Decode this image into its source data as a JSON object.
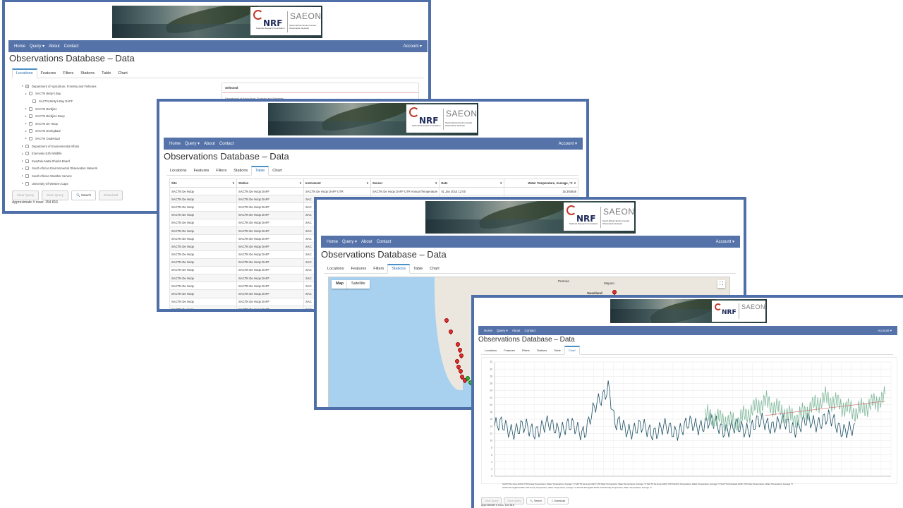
{
  "common": {
    "title": "Observations Database – Data",
    "nav": {
      "home": "Home",
      "query": "Query ▾",
      "about": "About",
      "contact": "Contact",
      "account": "Account ▾"
    },
    "logo": {
      "nrf": "NRF",
      "nrf_sub": "National Research Foundation",
      "saeon": "SAEON",
      "saeon_sub": "South African Environmental Observation Network"
    }
  },
  "w1": {
    "tabs": [
      "Locations",
      "Features",
      "Filters",
      "Stations",
      "Table",
      "Chart"
    ],
    "tree": [
      {
        "label": "Department of Agriculture, Forestry and Fisheries",
        "toggle": "▾",
        "indent": 0
      },
      {
        "label": "SACTN Betty's Bay",
        "toggle": "▸",
        "indent": 1
      },
      {
        "label": "SACTN Betty's Bay DAFF",
        "toggle": "",
        "indent": 2
      },
      {
        "label": "SACTN Bordjies",
        "toggle": "▸",
        "indent": 1
      },
      {
        "label": "SACTN Bordjies Deep",
        "toggle": "▸",
        "indent": 1
      },
      {
        "label": "SACTN De Hoop",
        "toggle": "▸",
        "indent": 1
      },
      {
        "label": "SACTN Doringbaai",
        "toggle": "▸",
        "indent": 1
      },
      {
        "label": "SACTN Oudekraal",
        "toggle": "▸",
        "indent": 1
      },
      {
        "label": "Department of Environmental Affairs",
        "toggle": "▸",
        "indent": 0
      },
      {
        "label": "Ezemvelo KZN Wildlife",
        "toggle": "▸",
        "indent": 0
      },
      {
        "label": "KwaZulu-Natal Sharks Board",
        "toggle": "▸",
        "indent": 0
      },
      {
        "label": "South African Environmental Observation Network",
        "toggle": "▸",
        "indent": 0
      },
      {
        "label": "South African Weather Service",
        "toggle": "▸",
        "indent": 0
      },
      {
        "label": "University Of Western Cape",
        "toggle": "▸",
        "indent": 0
      }
    ],
    "selected_header": "Selected",
    "selected_item": "Department of Agriculture, Forestry and Fisheries",
    "buttons": [
      "Clear Query",
      "Save Query",
      "🔍 Search",
      "Download"
    ],
    "rows_text": "Approximate # rows: 154 816"
  },
  "w2": {
    "tabs": [
      "Locations",
      "Features",
      "Filters",
      "Stations",
      "Table",
      "Chart"
    ],
    "columns": [
      "Site",
      "Station",
      "Instrument",
      "Sensor",
      "Date",
      "Water Temperature, Average, °C"
    ],
    "first_row": [
      "SACTN De Hoop",
      "SACTN De Hoop DAFF",
      "SACTN De Hoop DAFF UTR",
      "SACTN De Hoop DAFF UTR Annual Temperature",
      "01 Jan 2014 12:00",
      "16.393648"
    ],
    "site": "SACTN De Hoop",
    "station": "SACTN De Hoop DAFF",
    "instrument_prefix": "SAC"
  },
  "w3": {
    "tabs": [
      "Locations",
      "Features",
      "Filters",
      "Stations",
      "Table",
      "Chart"
    ],
    "map_btn": "Map",
    "sat_btn": "Satellite",
    "places": {
      "pretoria": "Pretoria",
      "swaziland": "Swaziland",
      "maputo": "Maputo"
    }
  },
  "w4": {
    "tabs": [
      "Locations",
      "Features",
      "Filters",
      "Stations",
      "Table",
      "Chart"
    ],
    "buttons": [
      "Clear Query",
      "Save Query",
      "🔍 Search",
      "⇩ Download"
    ],
    "rows_text": "Approximate # rows: 154 816",
    "legend1": "SACTN De Hoop DAFF UTR Annual Temperature, Water Temperature, Average °C   SACTN De Hoop DAFF UTR Daily Temperature, Water Temperature, Average °C   SACTN De Hoop DAFF UTR Monthly Temperature, Water Temperature, Average °C   SACTN Doringbaai DAFF UTR Daily Temperature, Water Temperature, Average °C",
    "legend2": "SACTN Doringbaai DAFF UTR Hourly Temperature, Water Temperature, Average °C   SACTN Doringbaai DAFF UTR Monthly Temperature, Water Temperature, Average °C"
  },
  "chart_data": {
    "type": "line",
    "title": "",
    "xlabel": "",
    "ylabel": "",
    "ylim": [
      0,
      32
    ],
    "yticks": [
      0,
      2,
      4,
      6,
      8,
      10,
      12,
      14,
      16,
      18,
      20,
      22,
      24,
      26,
      28,
      30,
      32
    ],
    "grid": true,
    "legend": "bottom",
    "series": [
      {
        "color": "#1b4f63",
        "x": [
          2011.0,
          2011.5,
          2012.0,
          2012.5,
          2012.9,
          2013.0,
          2013.5,
          2014.0,
          2014.5,
          2015.0,
          2015.5,
          2016.0,
          2016.5,
          2017.0
        ],
        "values": [
          14,
          13,
          14,
          13,
          26,
          14,
          13,
          13,
          15,
          13,
          15,
          14,
          16,
          12
        ]
      },
      {
        "color": "#7fb89b",
        "x": [
          2014.5,
          2015.0,
          2015.5,
          2016.0,
          2016.5,
          2017.0,
          2017.5
        ],
        "values": [
          17,
          15,
          21,
          16,
          22,
          18,
          22
        ]
      },
      {
        "color": "#cf6a6a",
        "x": [
          2015.5,
          2016.5,
          2017.5
        ],
        "values": [
          17,
          19,
          21
        ]
      }
    ],
    "xlim": [
      2011,
      2017.6
    ]
  }
}
